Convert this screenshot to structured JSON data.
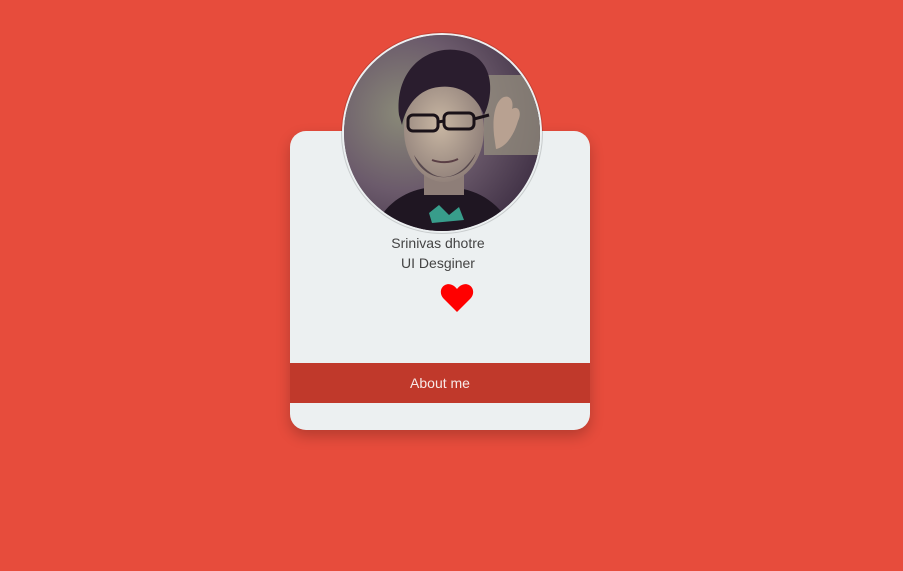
{
  "profile": {
    "name": "Srinivas dhotre",
    "title": "UI Desginer",
    "avatar_icon": "profile-photo",
    "like_icon": "heart-icon"
  },
  "actions": {
    "about_label": "About me"
  },
  "colors": {
    "background": "#e74c3c",
    "card": "#ecf0f1",
    "button": "#c0392b",
    "heart": "#ff0000"
  }
}
